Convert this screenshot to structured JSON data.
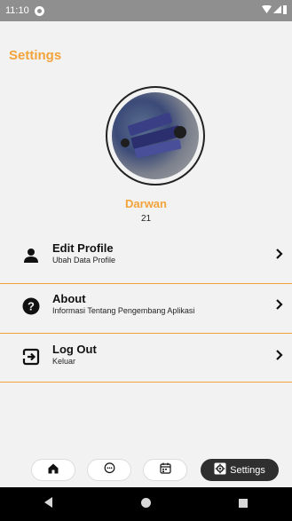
{
  "status_bar": {
    "time": "11:10"
  },
  "header": {
    "title": "Settings"
  },
  "profile": {
    "name": "Darwan",
    "age": "21"
  },
  "menu": [
    {
      "title": "Edit Profile",
      "subtitle": "Ubah Data Profile",
      "icon": "person-icon"
    },
    {
      "title": "About",
      "subtitle": "Informasi Tentang Pengembang Aplikasi",
      "icon": "help-icon"
    },
    {
      "title": "Log Out",
      "subtitle": "Keluar",
      "icon": "logout-icon"
    }
  ],
  "bottom_nav": {
    "items": [
      "home-icon",
      "chat-icon",
      "calendar-icon",
      "settings-icon"
    ],
    "active_label": "Settings"
  },
  "colors": {
    "accent": "#f2a33a",
    "active_pill": "#2f2f2f",
    "background": "#f2f2f2"
  }
}
